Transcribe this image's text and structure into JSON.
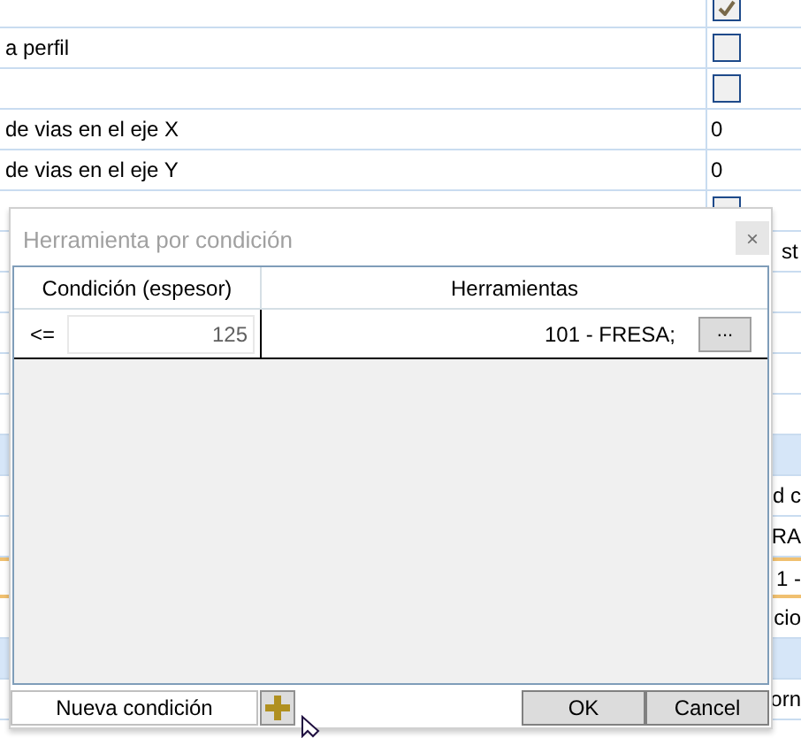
{
  "property_grid": {
    "rows": [
      {
        "kind": "checkbox",
        "label": "",
        "checked": true
      },
      {
        "kind": "checkbox",
        "label": "a perfil",
        "checked": false
      },
      {
        "kind": "checkbox",
        "label": "",
        "checked": false
      },
      {
        "kind": "text",
        "label": "de vias en el eje X",
        "value": "0"
      },
      {
        "kind": "text",
        "label": "de vias en el eje Y",
        "value": "0"
      },
      {
        "kind": "checkbox",
        "label": "",
        "checked": false
      },
      {
        "kind": "partial",
        "label": "",
        "value": "st"
      },
      {
        "kind": "partial",
        "label": "",
        "value": ""
      },
      {
        "kind": "partial",
        "label": "",
        "value": ""
      },
      {
        "kind": "partial",
        "label": "",
        "value": ""
      },
      {
        "kind": "partial",
        "label": "",
        "value": ""
      },
      {
        "kind": "category",
        "label": "",
        "value": ""
      },
      {
        "kind": "partial",
        "label": "",
        "value": "d c"
      },
      {
        "kind": "partial",
        "label": "",
        "value": "RA"
      },
      {
        "kind": "highlight",
        "label": "",
        "value": "1 -"
      },
      {
        "kind": "partial",
        "label": "",
        "value": "cio"
      },
      {
        "kind": "category",
        "label": "",
        "value": ""
      },
      {
        "kind": "partial",
        "label": "",
        "value": "orn"
      }
    ]
  },
  "dialog": {
    "title": "Herramienta por condición",
    "close": "×",
    "columns": [
      "Condición (espesor)",
      "Herramientas"
    ],
    "rows": [
      {
        "operator": "<=",
        "value": "125",
        "tools": "101 - FRESA;",
        "browse": "..."
      }
    ],
    "new_condition": {
      "placeholder": "Nueva condición"
    },
    "buttons": [
      "OK",
      "Cancel"
    ]
  }
}
